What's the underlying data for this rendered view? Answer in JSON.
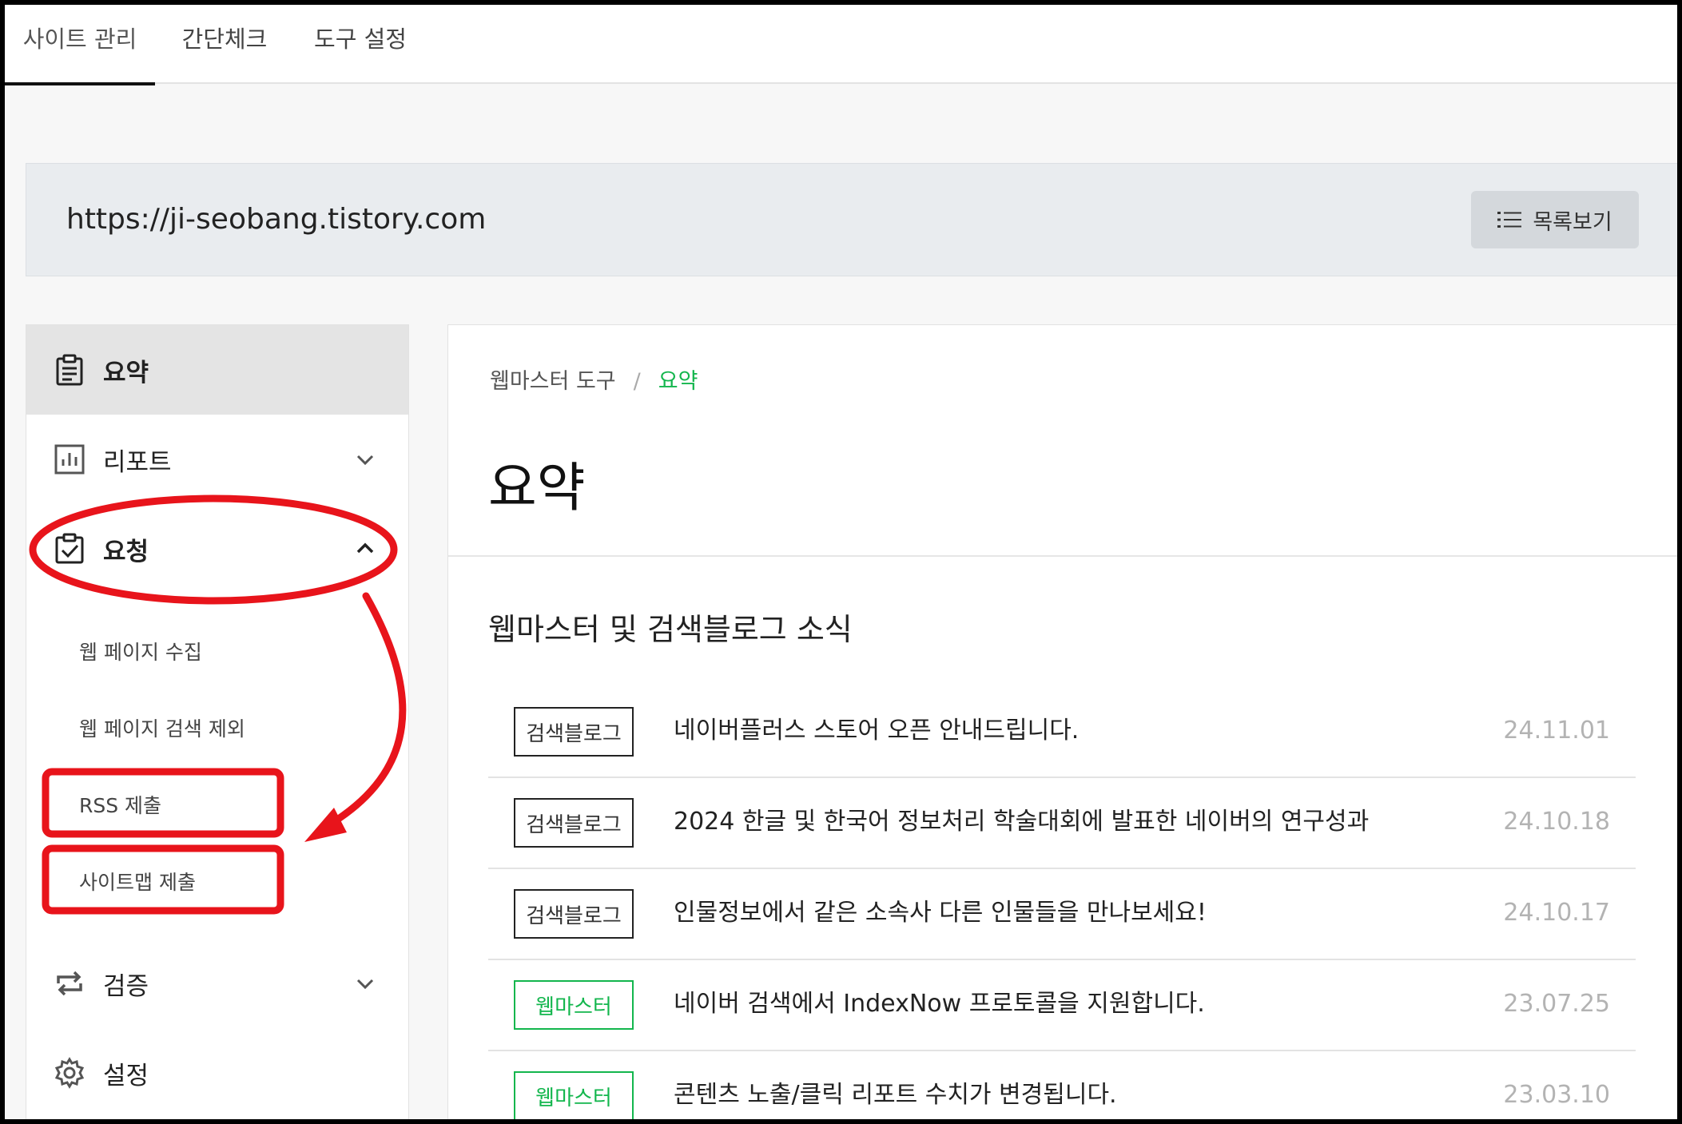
{
  "tabs": [
    {
      "label": "사이트 관리",
      "active": true
    },
    {
      "label": "간단체크",
      "active": false
    },
    {
      "label": "도구 설정",
      "active": false
    }
  ],
  "site": {
    "url": "https://ji-seobang.tistory.com",
    "list_button": "목록보기"
  },
  "sidebar": {
    "items": [
      {
        "label": "요약",
        "icon": "clipboard-icon",
        "active": true
      },
      {
        "label": "리포트",
        "icon": "chart-icon",
        "expanded": false
      },
      {
        "label": "요청",
        "icon": "clipboard-check-icon",
        "expanded": true
      },
      {
        "label": "검증",
        "icon": "repeat-icon",
        "expanded": false
      },
      {
        "label": "설정",
        "icon": "gear-icon"
      }
    ],
    "subitems": [
      "웹 페이지 수집",
      "웹 페이지 검색 제외",
      "RSS 제출",
      "사이트맵 제출"
    ]
  },
  "main": {
    "breadcrumb": {
      "root": "웹마스터 도구",
      "sep": "/",
      "current": "요약"
    },
    "title": "요약",
    "news_title": "웹마스터 및 검색블로그 소식",
    "news": [
      {
        "badge": "검색블로그",
        "badge_color": "#222222",
        "title": "네이버플러스 스토어 오픈 안내드립니다.",
        "date": "24.11.01"
      },
      {
        "badge": "검색블로그",
        "badge_color": "#222222",
        "title": "2024 한글 및 한국어 정보처리 학술대회에 발표한 네이버의 연구성과",
        "date": "24.10.18"
      },
      {
        "badge": "검색블로그",
        "badge_color": "#222222",
        "title": "인물정보에서 같은 소속사 다른 인물들을 만나보세요!",
        "date": "24.10.17"
      },
      {
        "badge": "웹마스터",
        "badge_color": "#13b64d",
        "title": "네이버 검색에서 IndexNow 프로토콜을 지원합니다.",
        "date": "23.07.25"
      },
      {
        "badge": "웹마스터",
        "badge_color": "#13b64d",
        "title": "콘텐츠 노출/클릭 리포트 수치가 변경됩니다.",
        "date": "23.03.10"
      }
    ]
  },
  "colors": {
    "accent_green": "#13b64d",
    "annotation_red": "#e8141b"
  }
}
